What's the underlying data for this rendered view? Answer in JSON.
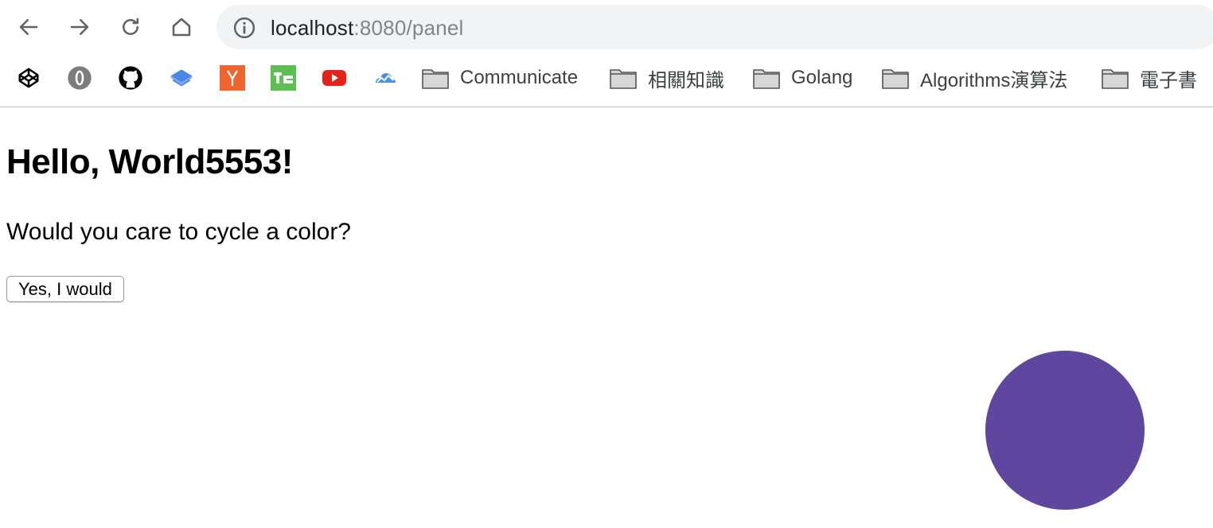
{
  "browser": {
    "nav": {
      "back_icon": "back-arrow-icon",
      "forward_icon": "forward-arrow-icon",
      "reload_icon": "reload-icon",
      "home_icon": "home-icon"
    },
    "address_bar": {
      "info_icon": "info-icon",
      "url_host": "localhost",
      "url_rest": ":8080/panel"
    },
    "bookmarks": {
      "icons": [
        {
          "name": "codepen-icon",
          "color": "#000000"
        },
        {
          "name": "opera-icon",
          "color": "#7d7d7d"
        },
        {
          "name": "github-icon",
          "color": "#000000"
        },
        {
          "name": "book-icon",
          "color": "#4a86e8"
        },
        {
          "name": "ycombinator-icon",
          "color": "#f0652f",
          "glyph": "Y"
        },
        {
          "name": "techcrunch-icon",
          "color": "#5bbf52",
          "glyph": "TC"
        },
        {
          "name": "youtube-icon",
          "color": "#e62117"
        },
        {
          "name": "cloud-chart-icon",
          "color": "#4a90e2"
        }
      ],
      "folders": [
        {
          "label": "Communicate"
        },
        {
          "label": "相關知識"
        },
        {
          "label": "Golang"
        },
        {
          "label": "Algorithms演算法"
        },
        {
          "label": "電子書"
        }
      ]
    }
  },
  "page": {
    "heading": "Hello, World5553!",
    "question": "Would you care to cycle a color?",
    "button_label": "Yes, I would",
    "circle_color": "#5f469f"
  }
}
